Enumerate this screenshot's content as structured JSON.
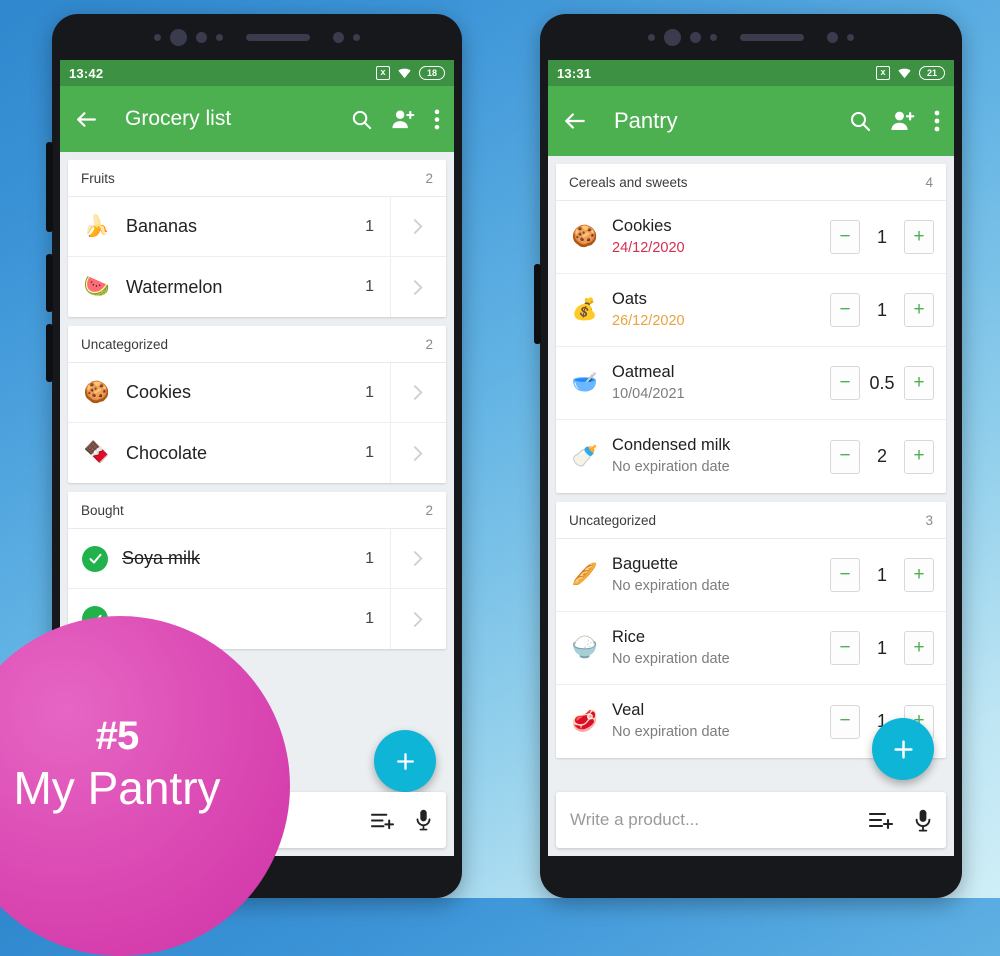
{
  "background": {
    "from": "#2f87cd",
    "to": "#cfeef7"
  },
  "badge": {
    "rank": "#5",
    "label": "My Pantry",
    "color": "#dd4fb6"
  },
  "theme": {
    "green": "#4caf50",
    "status_green": "#3c9142",
    "fab": "#0fb5d6",
    "check_green": "#21b24b"
  },
  "phones": [
    {
      "statusbar": {
        "time": "13:42",
        "battery": "18",
        "nosim_icon": "no-sim-icon",
        "wifi_icon": "wifi-icon"
      },
      "appbar": {
        "back_icon": "arrow-back-icon",
        "title": "Grocery list",
        "search_icon": "search-icon",
        "add_person_icon": "person-add-icon",
        "overflow_icon": "more-vert-icon"
      },
      "categories": [
        {
          "name": "Fruits",
          "count": "2",
          "items": [
            {
              "emoji": "🍌",
              "icon_name": "banana-emoji",
              "name": "Bananas",
              "qty": "1",
              "bought": false
            },
            {
              "emoji": "🍉",
              "icon_name": "watermelon-emoji",
              "name": "Watermelon",
              "qty": "1",
              "bought": false
            }
          ]
        },
        {
          "name": "Uncategorized",
          "count": "2",
          "items": [
            {
              "emoji": "🍪",
              "icon_name": "cookie-emoji",
              "name": "Cookies",
              "qty": "1",
              "bought": false
            },
            {
              "emoji": "🍫",
              "icon_name": "chocolate-emoji",
              "name": "Chocolate",
              "qty": "1",
              "bought": false
            }
          ]
        },
        {
          "name": "Bought",
          "count": "2",
          "items": [
            {
              "emoji": "",
              "icon_name": "check-circle-icon",
              "name": "Soya milk",
              "qty": "1",
              "bought": true
            },
            {
              "emoji": "",
              "icon_name": "check-circle-icon",
              "name": "",
              "qty": "1",
              "bought": true
            }
          ]
        }
      ],
      "fab": {
        "icon": "plus-icon"
      },
      "inputbar": {
        "placeholder": "",
        "list_add_icon": "playlist-add-icon",
        "mic_icon": "microphone-icon"
      }
    },
    {
      "statusbar": {
        "time": "13:31",
        "battery": "21",
        "nosim_icon": "no-sim-icon",
        "wifi_icon": "wifi-icon"
      },
      "appbar": {
        "back_icon": "arrow-back-icon",
        "title": "Pantry",
        "search_icon": "search-icon",
        "add_person_icon": "person-add-icon",
        "overflow_icon": "more-vert-icon"
      },
      "categories": [
        {
          "name": "Cereals and sweets",
          "count": "4",
          "items": [
            {
              "emoji": "🍪",
              "icon_name": "cookie-emoji",
              "name": "Cookies",
              "date": "24/12/2020",
              "date_color": "#d32f4f",
              "qty": "1"
            },
            {
              "emoji": "💰",
              "icon_name": "oats-sack-emoji",
              "name": "Oats",
              "date": "26/12/2020",
              "date_color": "#e8a33d",
              "qty": "1"
            },
            {
              "emoji": "🥣",
              "icon_name": "oatmeal-bowl-emoji",
              "name": "Oatmeal",
              "date": "10/04/2021",
              "date_color": "#7d7d7d",
              "qty": "0.5"
            },
            {
              "emoji": "🍼",
              "icon_name": "condensed-milk-emoji",
              "name": "Condensed milk",
              "date": "No expiration date",
              "date_color": "#7d7d7d",
              "qty": "2"
            }
          ]
        },
        {
          "name": "Uncategorized",
          "count": "3",
          "items": [
            {
              "emoji": "🥖",
              "icon_name": "baguette-emoji",
              "name": "Baguette",
              "date": "No expiration date",
              "date_color": "#7d7d7d",
              "qty": "1"
            },
            {
              "emoji": "🍚",
              "icon_name": "rice-bowl-emoji",
              "name": "Rice",
              "date": "No expiration date",
              "date_color": "#7d7d7d",
              "qty": "1"
            },
            {
              "emoji": "🥩",
              "icon_name": "veal-meat-emoji",
              "name": "Veal",
              "date": "No expiration date",
              "date_color": "#7d7d7d",
              "qty": "1"
            }
          ]
        }
      ],
      "stepper": {
        "minus_label": "−",
        "plus_label": "+"
      },
      "fab": {
        "icon": "plus-icon"
      },
      "inputbar": {
        "placeholder": "Write a product...",
        "list_add_icon": "playlist-add-icon",
        "mic_icon": "microphone-icon"
      }
    }
  ]
}
